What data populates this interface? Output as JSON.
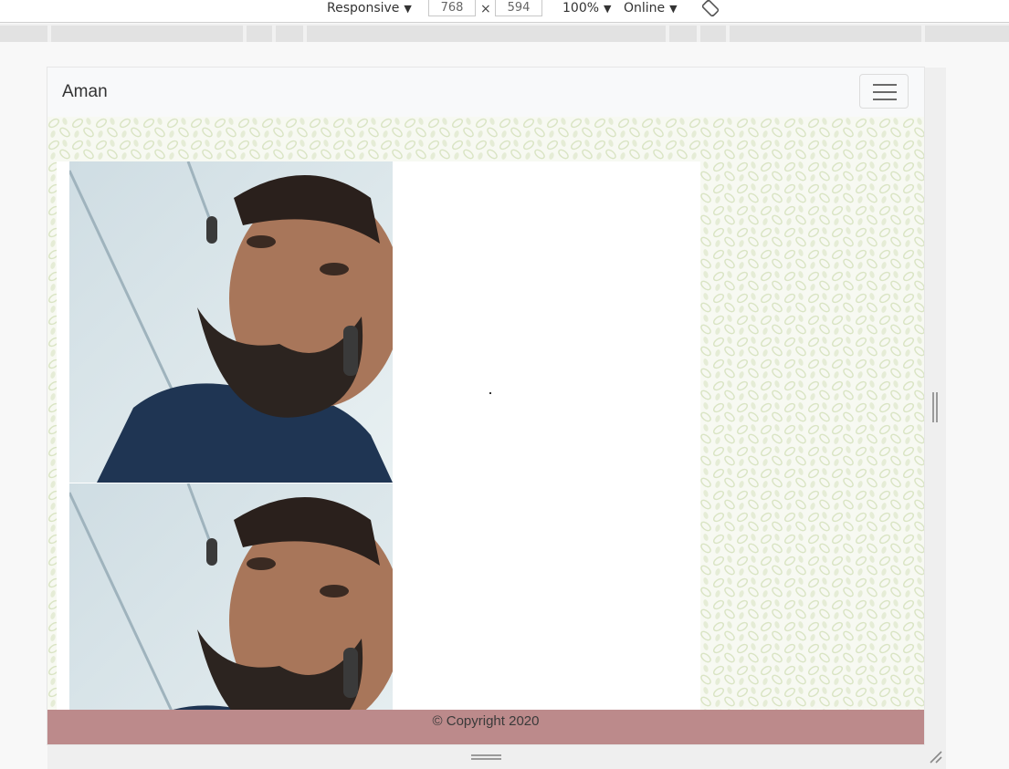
{
  "devtools": {
    "device": "Responsive",
    "width": "768",
    "height": "594",
    "times": "×",
    "zoom": "100%",
    "throttle": "Online",
    "arrow": "▼"
  },
  "page": {
    "brand": "Aman",
    "footer": "© Copyright 2020"
  },
  "colors": {
    "navbar_bg": "#f8f9fa",
    "footer_bg": "#bc8a8b",
    "pattern_leaf": "#d9e4c3",
    "shirt": "#1f3553"
  },
  "icons": {
    "toggler": "hamburger-menu-icon",
    "rotate": "rotate-device-icon"
  }
}
